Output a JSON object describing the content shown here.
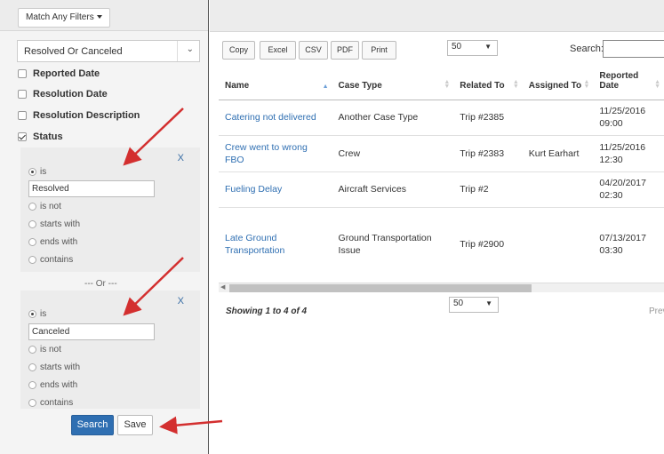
{
  "filters": {
    "match_button": "Match Any Filters",
    "status_select_value": "Resolved Or Canceled",
    "fields": [
      {
        "label": "Reported Date",
        "checked": false
      },
      {
        "label": "Resolution Date",
        "checked": false
      },
      {
        "label": "Resolution Description",
        "checked": false
      },
      {
        "label": "Status",
        "checked": true
      }
    ],
    "remove_label": "X",
    "or_separator": "--- Or ---",
    "conditions": [
      {
        "selected": "is",
        "value": "Resolved",
        "options": [
          "is",
          "is not",
          "starts with",
          "ends with",
          "contains"
        ]
      },
      {
        "selected": "is",
        "value": "Canceled",
        "options": [
          "is",
          "is not",
          "starts with",
          "ends with",
          "contains"
        ]
      }
    ],
    "search_button": "Search",
    "save_button": "Save"
  },
  "table": {
    "buttons": [
      "Copy",
      "Excel",
      "CSV",
      "PDF",
      "Print"
    ],
    "page_length": "50",
    "search_label": "Search:",
    "columns": [
      "Name",
      "Case Type",
      "Related To",
      "Assigned To",
      "Reported Date"
    ],
    "rows": [
      {
        "name": "Catering not delivered",
        "case_type": "Another Case Type",
        "related_to": "Trip #2385",
        "assigned_to": "",
        "reported": "11/25/2016 09:00"
      },
      {
        "name": "Crew went to wrong FBO",
        "case_type": "Crew",
        "related_to": "Trip #2383",
        "assigned_to": "Kurt Earhart",
        "reported": "11/25/2016 12:30"
      },
      {
        "name": "Fueling Delay",
        "case_type": "Aircraft Services",
        "related_to": "Trip #2",
        "assigned_to": "",
        "reported": "04/20/2017 02:30"
      },
      {
        "name": "Late Ground Transportation",
        "case_type": "Ground Transportation Issue",
        "related_to": "Trip #2900",
        "assigned_to": "",
        "reported": "07/13/2017 03:30"
      }
    ],
    "info": "Showing 1 to 4 of 4",
    "bottom_page_length": "50",
    "prev_label": "Prev"
  },
  "colors": {
    "primary": "#2f6fb2",
    "arrow": "#d32f2f"
  }
}
